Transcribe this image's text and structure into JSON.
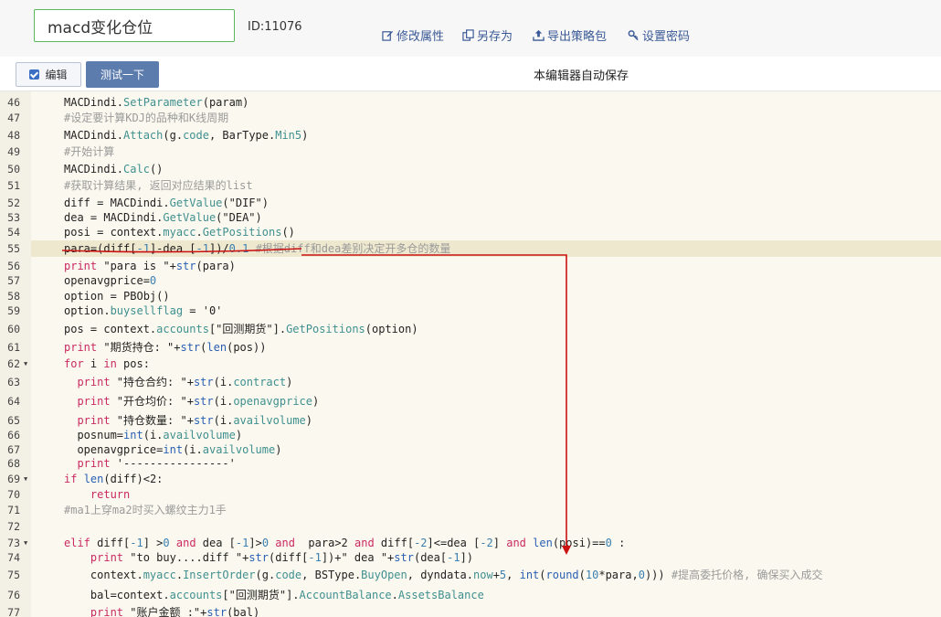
{
  "strategy": {
    "name": "macd变化仓位",
    "id_label": "ID:11076"
  },
  "header_actions": [
    {
      "label": "修改属性",
      "icon": "edit-icon"
    },
    {
      "label": "另存为",
      "icon": "copy-icon"
    },
    {
      "label": "导出策略包",
      "icon": "export-icon"
    },
    {
      "label": "设置密码",
      "icon": "key-icon"
    }
  ],
  "toolbar": {
    "edit_label": "编辑",
    "test_label": "测试一下",
    "autosave_text": "本编辑器自动保存"
  },
  "editor": {
    "highlighted_line": 55,
    "annotation_color": "#cc1111",
    "lines": [
      {
        "n": "46",
        "tokens": [
          [
            "p",
            "MACDindi."
          ],
          [
            "f",
            "SetParameter"
          ],
          [
            "p",
            "(param)"
          ]
        ]
      },
      {
        "n": "47",
        "tokens": [
          [
            "c",
            "#设定要计算KDJ的品种和K线周期"
          ]
        ]
      },
      {
        "n": "48",
        "tokens": [
          [
            "p",
            "MACDindi."
          ],
          [
            "f",
            "Attach"
          ],
          [
            "p",
            "(g."
          ],
          [
            "f",
            "code"
          ],
          [
            "p",
            ", BarType."
          ],
          [
            "f",
            "Min5"
          ],
          [
            "p",
            ")"
          ]
        ]
      },
      {
        "n": "49",
        "tokens": [
          [
            "c",
            "#开始计算"
          ]
        ]
      },
      {
        "n": "50",
        "tokens": [
          [
            "p",
            "MACDindi."
          ],
          [
            "f",
            "Calc"
          ],
          [
            "p",
            "()"
          ]
        ]
      },
      {
        "n": "51",
        "tokens": [
          [
            "c",
            "#获取计算结果, 返回对应结果的list"
          ]
        ]
      },
      {
        "n": "52",
        "tokens": [
          [
            "p",
            "diff = MACDindi."
          ],
          [
            "f",
            "GetValue"
          ],
          [
            "p",
            "(\"DIF\")"
          ]
        ]
      },
      {
        "n": "53",
        "tokens": [
          [
            "p",
            "dea = MACDindi."
          ],
          [
            "f",
            "GetValue"
          ],
          [
            "p",
            "(\"DEA\")"
          ]
        ]
      },
      {
        "n": "54",
        "tokens": [
          [
            "p",
            "posi = context."
          ],
          [
            "f",
            "myacc"
          ],
          [
            "p",
            "."
          ],
          [
            "f",
            "GetPositions"
          ],
          [
            "p",
            "()"
          ]
        ]
      },
      {
        "n": "55",
        "tokens": [
          [
            "p",
            "para=(diff["
          ],
          [
            "u",
            "-1"
          ],
          [
            "p",
            "]-dea ["
          ],
          [
            "u",
            "-1"
          ],
          [
            "p",
            "])/"
          ],
          [
            "u",
            "0.1"
          ],
          [
            "p",
            " "
          ],
          [
            "c",
            "#根据diff和dea差别决定开多仓的数量"
          ]
        ]
      },
      {
        "n": "56",
        "tokens": [
          [
            "k",
            "print"
          ],
          [
            "p",
            " \"para is \"+"
          ],
          [
            "b",
            "str"
          ],
          [
            "p",
            "(para)"
          ]
        ]
      },
      {
        "n": "57",
        "tokens": [
          [
            "p",
            "openavgprice="
          ],
          [
            "u",
            "0"
          ]
        ]
      },
      {
        "n": "58",
        "tokens": [
          [
            "p",
            "option = PBObj()"
          ]
        ]
      },
      {
        "n": "59",
        "tokens": [
          [
            "p",
            "option."
          ],
          [
            "f",
            "buysellflag"
          ],
          [
            "p",
            " = '0'"
          ]
        ]
      },
      {
        "n": "60",
        "tokens": [
          [
            "p",
            "pos = context."
          ],
          [
            "f",
            "accounts"
          ],
          [
            "p",
            "[\"回测期货\"]."
          ],
          [
            "f",
            "GetPositions"
          ],
          [
            "p",
            "(option)"
          ]
        ]
      },
      {
        "n": "61",
        "tokens": [
          [
            "k",
            "print"
          ],
          [
            "p",
            " \"期货持仓: \"+"
          ],
          [
            "b",
            "str"
          ],
          [
            "p",
            "("
          ],
          [
            "b",
            "len"
          ],
          [
            "p",
            "(pos))"
          ]
        ]
      },
      {
        "n": "62",
        "fold": true,
        "tokens": [
          [
            "k",
            "for"
          ],
          [
            "p",
            " i "
          ],
          [
            "k",
            "in"
          ],
          [
            "p",
            " pos:"
          ]
        ]
      },
      {
        "n": "63",
        "tokens": [
          [
            "p",
            "  "
          ],
          [
            "k",
            "print"
          ],
          [
            "p",
            " \"持仓合约: \"+"
          ],
          [
            "b",
            "str"
          ],
          [
            "p",
            "(i."
          ],
          [
            "f",
            "contract"
          ],
          [
            "p",
            ")"
          ]
        ]
      },
      {
        "n": "64",
        "tokens": [
          [
            "p",
            "  "
          ],
          [
            "k",
            "print"
          ],
          [
            "p",
            " \"开仓均价: \"+"
          ],
          [
            "b",
            "str"
          ],
          [
            "p",
            "(i."
          ],
          [
            "f",
            "openavgprice"
          ],
          [
            "p",
            ")"
          ]
        ]
      },
      {
        "n": "65",
        "tokens": [
          [
            "p",
            "  "
          ],
          [
            "k",
            "print"
          ],
          [
            "p",
            " \"持仓数量: \"+"
          ],
          [
            "b",
            "str"
          ],
          [
            "p",
            "(i."
          ],
          [
            "f",
            "availvolume"
          ],
          [
            "p",
            ")"
          ]
        ]
      },
      {
        "n": "66",
        "tokens": [
          [
            "p",
            "  posnum="
          ],
          [
            "b",
            "int"
          ],
          [
            "p",
            "(i."
          ],
          [
            "f",
            "availvolume"
          ],
          [
            "p",
            ")"
          ]
        ]
      },
      {
        "n": "67",
        "tokens": [
          [
            "p",
            "  openavgprice="
          ],
          [
            "b",
            "int"
          ],
          [
            "p",
            "(i."
          ],
          [
            "f",
            "availvolume"
          ],
          [
            "p",
            ")"
          ]
        ]
      },
      {
        "n": "68",
        "tokens": [
          [
            "p",
            "  "
          ],
          [
            "k",
            "print"
          ],
          [
            "p",
            " '----------------'"
          ]
        ]
      },
      {
        "n": "69",
        "fold": true,
        "tokens": [
          [
            "k",
            "if"
          ],
          [
            "p",
            " "
          ],
          [
            "b",
            "len"
          ],
          [
            "p",
            "(diff)<2:"
          ]
        ]
      },
      {
        "n": "70",
        "tokens": [
          [
            "p",
            "    "
          ],
          [
            "k",
            "return"
          ]
        ]
      },
      {
        "n": "71",
        "tokens": [
          [
            "c",
            "#ma1上穿ma2时买入螺纹主力1手"
          ]
        ]
      },
      {
        "n": "72",
        "tokens": []
      },
      {
        "n": "73",
        "fold": true,
        "tokens": [
          [
            "k",
            "elif"
          ],
          [
            "p",
            " diff["
          ],
          [
            "u",
            "-1"
          ],
          [
            "p",
            "] >"
          ],
          [
            "u",
            "0"
          ],
          [
            "p",
            " "
          ],
          [
            "k",
            "and"
          ],
          [
            "p",
            " dea ["
          ],
          [
            "u",
            "-1"
          ],
          [
            "p",
            "]>"
          ],
          [
            "u",
            "0"
          ],
          [
            "p",
            " "
          ],
          [
            "k",
            "and"
          ],
          [
            "p",
            "  para>2 "
          ],
          [
            "k",
            "and"
          ],
          [
            "p",
            " diff["
          ],
          [
            "u",
            "-2"
          ],
          [
            "p",
            "]<=dea ["
          ],
          [
            "u",
            "-2"
          ],
          [
            "p",
            "] "
          ],
          [
            "k",
            "and"
          ],
          [
            "p",
            " "
          ],
          [
            "b",
            "len"
          ],
          [
            "p",
            "(posi)=="
          ],
          [
            "u",
            "0"
          ],
          [
            "p",
            " :"
          ]
        ]
      },
      {
        "n": "74",
        "tokens": [
          [
            "p",
            "    "
          ],
          [
            "k",
            "print"
          ],
          [
            "p",
            " \"to buy....diff \"+"
          ],
          [
            "b",
            "str"
          ],
          [
            "p",
            "(diff["
          ],
          [
            "u",
            "-1"
          ],
          [
            "p",
            "])+\" dea \"+"
          ],
          [
            "b",
            "str"
          ],
          [
            "p",
            "(dea["
          ],
          [
            "u",
            "-1"
          ],
          [
            "p",
            "])"
          ]
        ]
      },
      {
        "n": "75",
        "tokens": [
          [
            "p",
            "    context."
          ],
          [
            "f",
            "myacc"
          ],
          [
            "p",
            "."
          ],
          [
            "f",
            "InsertOrder"
          ],
          [
            "p",
            "(g."
          ],
          [
            "f",
            "code"
          ],
          [
            "p",
            ", BSType."
          ],
          [
            "f",
            "BuyOpen"
          ],
          [
            "p",
            ", dyndata."
          ],
          [
            "f",
            "now"
          ],
          [
            "p",
            "+"
          ],
          [
            "u",
            "5"
          ],
          [
            "p",
            ", "
          ],
          [
            "b",
            "int"
          ],
          [
            "p",
            "("
          ],
          [
            "b",
            "round"
          ],
          [
            "p",
            "("
          ],
          [
            "u",
            "10"
          ],
          [
            "p",
            "*para,"
          ],
          [
            "u",
            "0"
          ],
          [
            "p",
            ")))"
          ],
          [
            "p",
            " "
          ],
          [
            "c",
            "#提高委托价格, 确保买入成交"
          ]
        ]
      },
      {
        "n": "76",
        "tokens": [
          [
            "p",
            "    bal=context."
          ],
          [
            "f",
            "accounts"
          ],
          [
            "p",
            "[\"回测期货\"]."
          ],
          [
            "f",
            "AccountBalance"
          ],
          [
            "p",
            "."
          ],
          [
            "f",
            "AssetsBalance"
          ]
        ]
      },
      {
        "n": "77",
        "tokens": [
          [
            "p",
            "    "
          ],
          [
            "k",
            "print"
          ],
          [
            "p",
            " \"账户金额 :\"+"
          ],
          [
            "b",
            "str"
          ],
          [
            "p",
            "(bal)"
          ]
        ]
      }
    ]
  }
}
